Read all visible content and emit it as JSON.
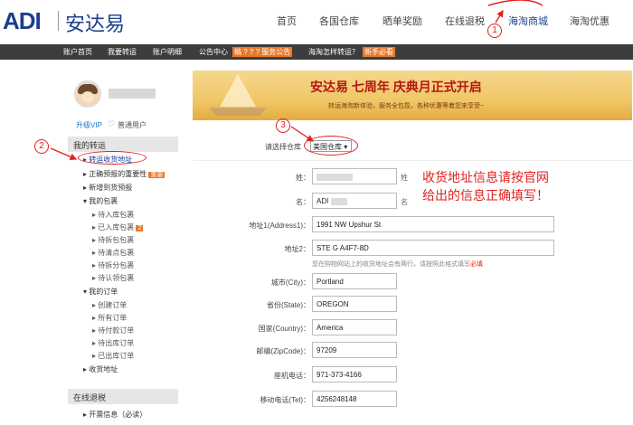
{
  "header": {
    "logo_en": "ADI",
    "logo_cn": "安达易",
    "nav": [
      "首页",
      "各国仓库",
      "晒单奖励",
      "在线退税",
      "海淘商城",
      "海淘优惠"
    ]
  },
  "bar": {
    "items": [
      "账户首页",
      "我要转运",
      "账户明细",
      "公告中心"
    ],
    "notice": "稿 ? ? ? 服务公告",
    "link": "海淘怎样转运？",
    "new_badge": "新手必看"
  },
  "sidebar": {
    "upgrade": "升级VIP",
    "level": "普通用户",
    "section1": "我的转运",
    "items": [
      "转运收货地址",
      "正确预报的重要性",
      "新增到货预报",
      "我的包裹",
      "待入库包裹",
      "已入库包裹",
      "待拆包包裹",
      "待清点包裹",
      "待拆分包裹",
      "待认领包裹",
      "我的订单",
      "创建订单",
      "所有订单",
      "待付款订单",
      "待出库订单",
      "已出库订单",
      "收货地址"
    ],
    "tag_important": "重要",
    "tag_count": "2",
    "section2": "在线退税",
    "item_refund": "开票信息（必读）"
  },
  "banner": {
    "title": "安达易 七周年 庆典月正式开启",
    "sub": "转运海淘新体验，服务全包揽，各种优惠等着您来享受~"
  },
  "form": {
    "warehouse_label": "请选择仓库",
    "warehouse_value": "美国仓库",
    "fields": [
      {
        "label": "姓：",
        "value": "",
        "suffix": "姓"
      },
      {
        "label": "名：",
        "value": "ADI",
        "suffix": "名"
      },
      {
        "label": "地址1(Address1)：",
        "value": "1991 NW Upshur St"
      },
      {
        "label": "地址2：",
        "value": "STE G A4F7-8D"
      },
      {
        "label": "城市(City)：",
        "value": "Portland"
      },
      {
        "label": "省份(State)：",
        "value": "OREGON"
      },
      {
        "label": "国家(Country)：",
        "value": "America"
      },
      {
        "label": "邮编(ZipCode)：",
        "value": "97209"
      },
      {
        "label": "座机电话：",
        "value": "971-373-4166"
      },
      {
        "label": "移动电话(Tel)：",
        "value": "4256248148"
      }
    ],
    "hint": "您在购物网站上的收货地址会有两行，请按照此格式填写",
    "hint_red": "必填",
    "annotation_line1": "收货地址信息请按官网",
    "annotation_line2": "给出的信息正确填写！"
  },
  "markers": {
    "m1": "1",
    "m2": "2",
    "m3": "3"
  },
  "colors": {
    "brand": "#1b3f8f",
    "accent": "#e8792a",
    "annotation": "#e02020",
    "bar": "#3d3d3d"
  }
}
